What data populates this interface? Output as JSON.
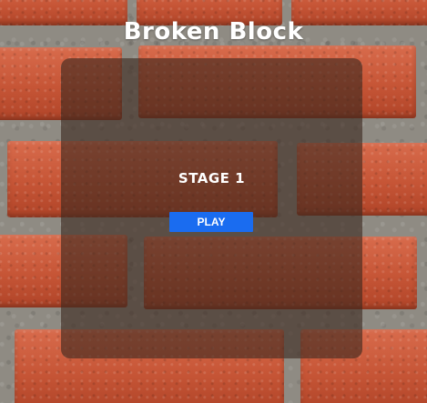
{
  "game": {
    "title": "Broken Block",
    "stage_label": "STAGE 1",
    "play_label": "PLAY"
  },
  "colors": {
    "brick": "#c65536",
    "mortar": "#8f8b83",
    "panel_overlay": "rgba(60, 40, 30, 0.62)",
    "play_button": "#1a6cf0",
    "text": "#ffffff"
  }
}
